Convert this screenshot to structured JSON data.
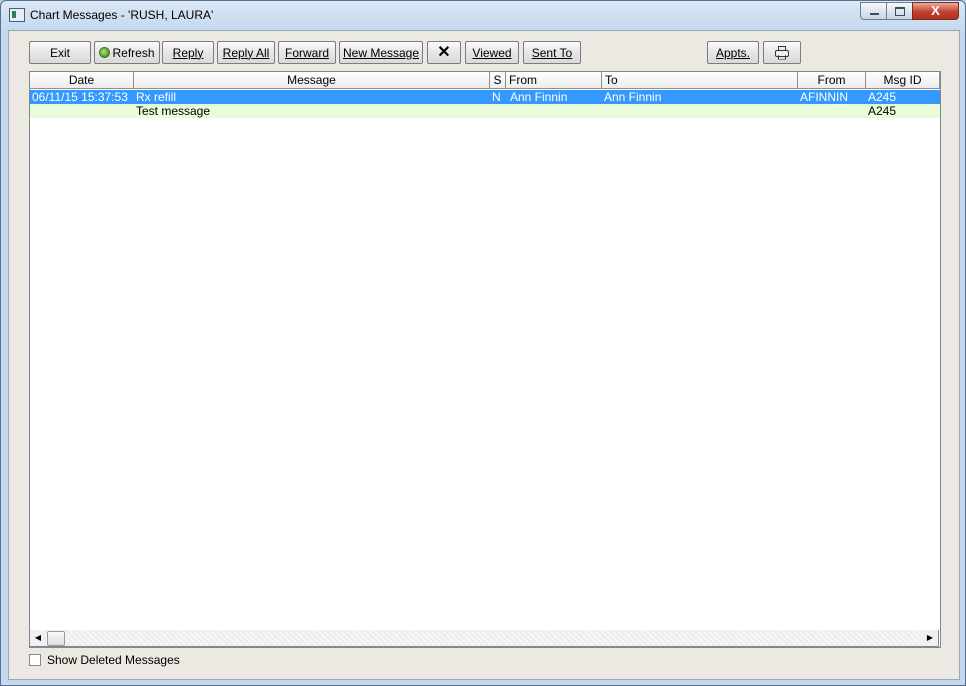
{
  "window": {
    "title": "Chart Messages - 'RUSH, LAURA'",
    "controls": {
      "minimize_icon": "minimize-icon",
      "maximize_icon": "maximize-icon",
      "close_label": "X"
    }
  },
  "toolbar": {
    "exit": "Exit",
    "refresh": "Refresh",
    "reply": "Reply",
    "reply_all": "Reply All",
    "forward": "Forward",
    "new_message": "New Message",
    "delete_icon": "x-icon",
    "delete_label": "✕",
    "viewed": "Viewed",
    "sent_to": "Sent To",
    "appts": "Appts.",
    "print_icon": "printer-icon"
  },
  "grid": {
    "columns": [
      "Date",
      "Message",
      "S",
      "From",
      "To",
      "From",
      "Msg ID"
    ],
    "rows": [
      {
        "date": "06/11/15 15:37:53",
        "message": "Rx refill",
        "s": "N",
        "from": "Ann Finnin",
        "to": "Ann Finnin",
        "from_id": "AFINNIN",
        "msg_id": "A245",
        "selected": true
      },
      {
        "date": "",
        "message": "Test message",
        "s": "",
        "from": "",
        "to": "",
        "from_id": "",
        "msg_id": "A245",
        "selected": false
      }
    ],
    "colors": {
      "selected": "#3399ff",
      "alt_row": "#e8fcd9"
    }
  },
  "scrollbar": {
    "left_arrow": "◀",
    "right_arrow": "▶"
  },
  "options": {
    "show_deleted_label": "Show Deleted Messages",
    "show_deleted_checked": false
  }
}
